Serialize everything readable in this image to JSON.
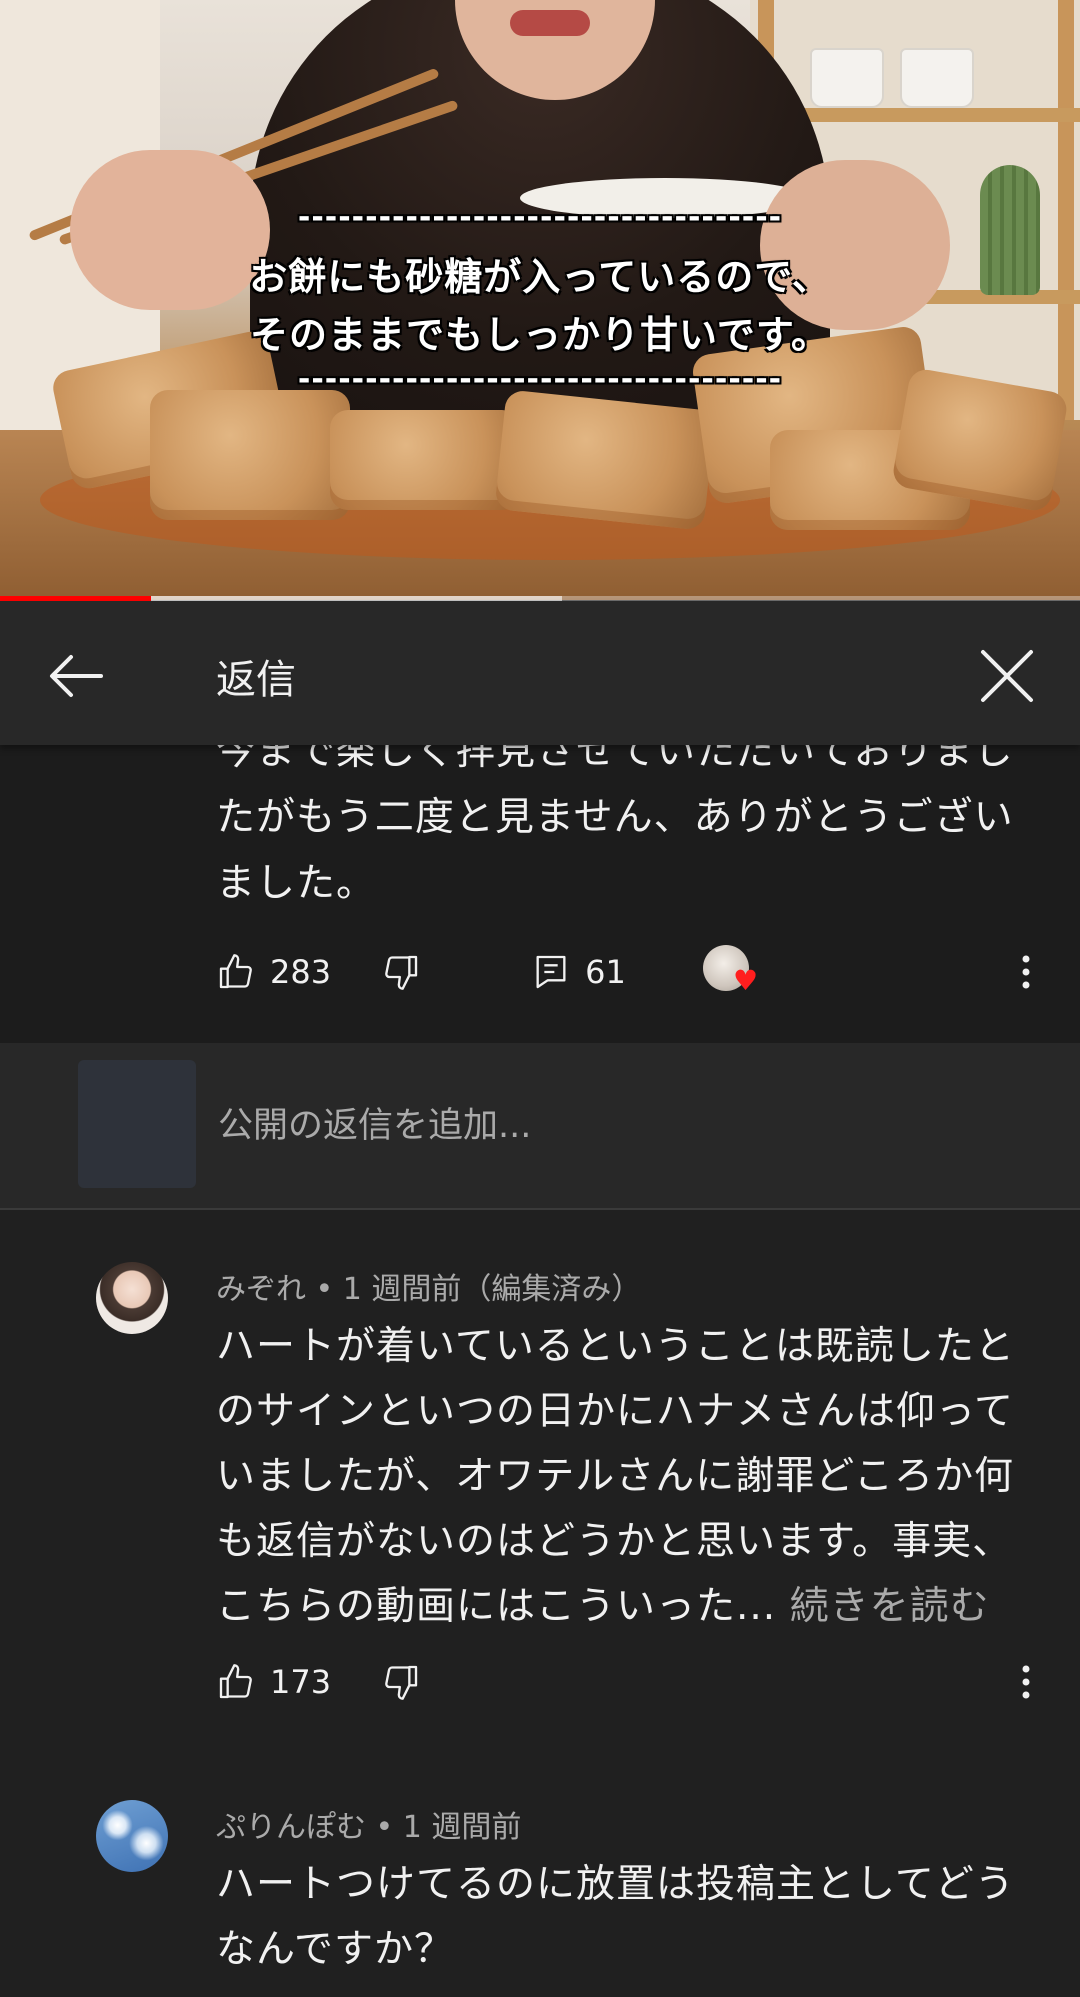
{
  "video": {
    "subtitle_line1": "お餅にも砂糖が入っているので、",
    "subtitle_line2": "そのままでもしっかり甘いです。",
    "subtitle_dash": "------------------------------------",
    "progress": 0.14,
    "buffered": 0.52
  },
  "header": {
    "title": "返信",
    "back_icon": "arrow-left-icon",
    "close_icon": "close-icon"
  },
  "parent_comment": {
    "text_line0": "今まで楽しく拝見させていただいておりまし",
    "text_line1": "たがもう二度と見ません、ありがとうござい",
    "text_line2": "ました。",
    "likes": "283",
    "replies": "61",
    "creator_heart": true
  },
  "add_reply": {
    "placeholder": "公開の返信を追加..."
  },
  "replies": [
    {
      "author": "みぞれ",
      "time": "1 週間前（編集済み）",
      "lines": [
        "ハートが着いているということは既読したと",
        "のサインといつの日かにハナメさんは仰って",
        "いましたが、オワテルさんに謝罪どころか何",
        "も返信がないのはどうかと思います。事実、",
        "こちらの動画にはこういった..."
      ],
      "read_more": "続きを読む",
      "likes": "173"
    },
    {
      "author": "ぷりんぽむ",
      "time": "1 週間前",
      "lines": [
        "ハートつけてるのに放置は投稿主としてどう",
        "なんですか？"
      ]
    }
  ],
  "separator": " • ",
  "colors": {
    "background": "#202020",
    "header": "#282828",
    "parent_bg": "#1c1c1c",
    "text": "#f1f1f1",
    "secondary_text": "#aaaaaa",
    "progress": "#ff0000",
    "heart": "#ff1e1e"
  }
}
